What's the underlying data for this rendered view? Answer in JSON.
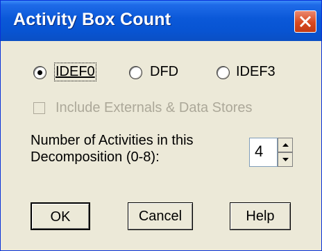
{
  "window": {
    "title": "Activity Box Count",
    "colors": {
      "titlebar": "#0a58d8",
      "close": "#d8491f",
      "face": "#ece9d8"
    }
  },
  "mode": {
    "options": [
      {
        "label": "IDEF0",
        "selected": true
      },
      {
        "label": "DFD",
        "selected": false
      },
      {
        "label": "IDEF3",
        "selected": false
      }
    ]
  },
  "include_externals": {
    "label": "Include Externals & Data Stores",
    "checked": false,
    "enabled": false
  },
  "activities": {
    "label_line1": "Number of Activities in this",
    "label_line2": "Decomposition (0-8):",
    "value": "4"
  },
  "buttons": {
    "ok": "OK",
    "cancel": "Cancel",
    "help": "Help"
  }
}
